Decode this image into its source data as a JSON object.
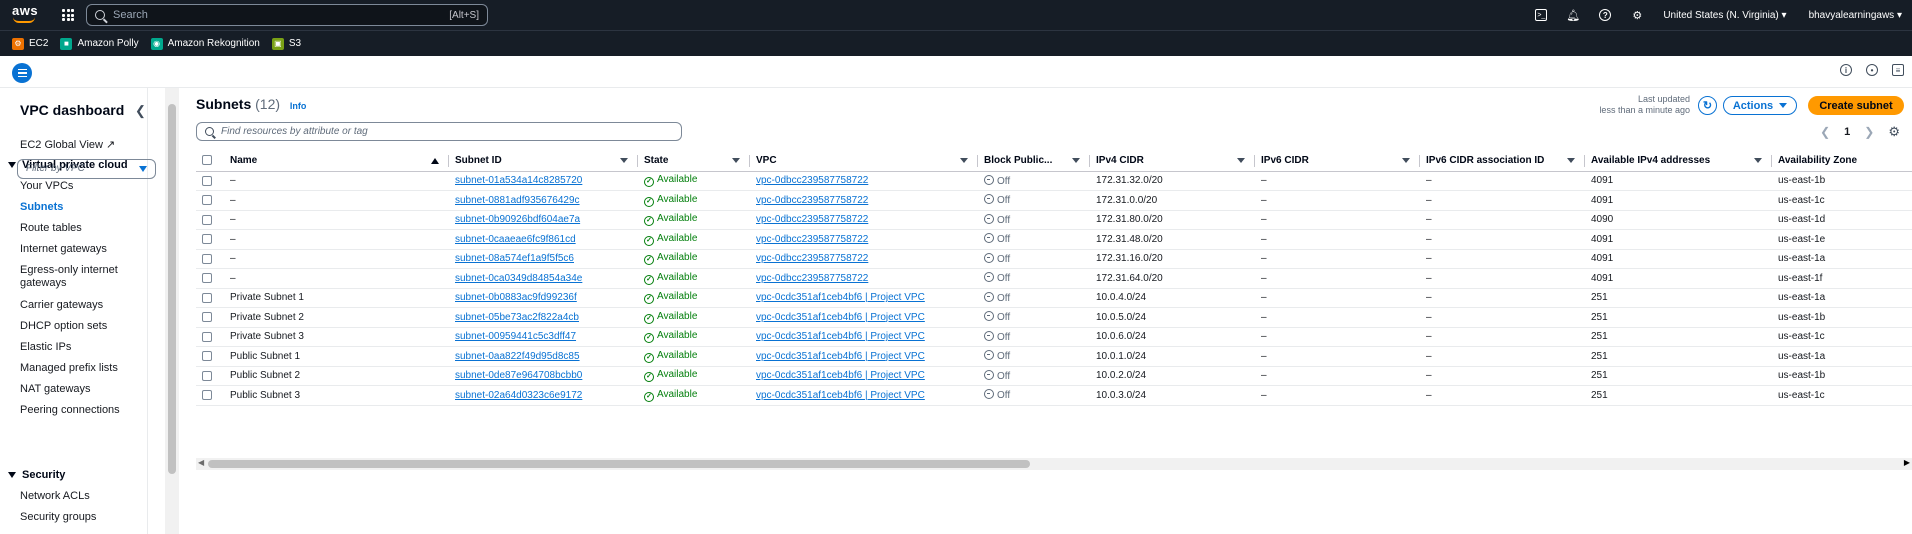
{
  "topnav": {
    "logo_text": "aws",
    "search_placeholder": "Search",
    "search_shortcut": "[Alt+S]",
    "region": "United States (N. Virginia)",
    "user": "bhavyalearningaws"
  },
  "favorites": [
    {
      "label": "EC2",
      "color": "#ed7100",
      "icon": "ec2-icon"
    },
    {
      "label": "Amazon Polly",
      "color": "#01a88d",
      "icon": "polly-icon"
    },
    {
      "label": "Amazon Rekognition",
      "color": "#01a88d",
      "icon": "rekognition-icon"
    },
    {
      "label": "S3",
      "color": "#7aa116",
      "icon": "s3-icon"
    }
  ],
  "sidebar": {
    "title": "VPC dashboard",
    "global_view": "EC2 Global View",
    "filter_placeholder": "Filter by VPC",
    "section_vpc": "Virtual private cloud",
    "items": [
      "Your VPCs",
      "Subnets",
      "Route tables",
      "Internet gateways",
      "Egress-only internet gateways",
      "Carrier gateways",
      "DHCP option sets",
      "Elastic IPs",
      "Managed prefix lists",
      "NAT gateways",
      "Peering connections"
    ],
    "section_security": "Security",
    "security_items": [
      "Network ACLs",
      "Security groups"
    ]
  },
  "main": {
    "title": "Subnets",
    "count": "(12)",
    "info": "Info",
    "last_updated_label": "Last updated",
    "last_updated_value": "less than a minute ago",
    "actions_label": "Actions",
    "create_label": "Create subnet",
    "search_placeholder": "Find resources by attribute or tag",
    "page": "1"
  },
  "table": {
    "columns": [
      "Name",
      "Subnet ID",
      "State",
      "VPC",
      "Block Public...",
      "IPv4 CIDR",
      "IPv6 CIDR",
      "IPv6 CIDR association ID",
      "Available IPv4 addresses",
      "Availability Zone"
    ],
    "rows": [
      {
        "name": "–",
        "subnet_id": "subnet-01a534a14c8285720",
        "state": "Available",
        "vpc": "vpc-0dbcc239587758722",
        "block": "Off",
        "ipv4": "172.31.32.0/20",
        "ipv6": "–",
        "ipv6_assoc": "–",
        "avail_ips": "4091",
        "az": "us-east-1b"
      },
      {
        "name": "–",
        "subnet_id": "subnet-0881adf935676429c",
        "state": "Available",
        "vpc": "vpc-0dbcc239587758722",
        "block": "Off",
        "ipv4": "172.31.0.0/20",
        "ipv6": "–",
        "ipv6_assoc": "–",
        "avail_ips": "4091",
        "az": "us-east-1c"
      },
      {
        "name": "–",
        "subnet_id": "subnet-0b90926bdf604ae7a",
        "state": "Available",
        "vpc": "vpc-0dbcc239587758722",
        "block": "Off",
        "ipv4": "172.31.80.0/20",
        "ipv6": "–",
        "ipv6_assoc": "–",
        "avail_ips": "4090",
        "az": "us-east-1d"
      },
      {
        "name": "–",
        "subnet_id": "subnet-0caaeae6fc9f861cd",
        "state": "Available",
        "vpc": "vpc-0dbcc239587758722",
        "block": "Off",
        "ipv4": "172.31.48.0/20",
        "ipv6": "–",
        "ipv6_assoc": "–",
        "avail_ips": "4091",
        "az": "us-east-1e"
      },
      {
        "name": "–",
        "subnet_id": "subnet-08a574ef1a9f5f5c6",
        "state": "Available",
        "vpc": "vpc-0dbcc239587758722",
        "block": "Off",
        "ipv4": "172.31.16.0/20",
        "ipv6": "–",
        "ipv6_assoc": "–",
        "avail_ips": "4091",
        "az": "us-east-1a"
      },
      {
        "name": "–",
        "subnet_id": "subnet-0ca0349d84854a34e",
        "state": "Available",
        "vpc": "vpc-0dbcc239587758722",
        "block": "Off",
        "ipv4": "172.31.64.0/20",
        "ipv6": "–",
        "ipv6_assoc": "–",
        "avail_ips": "4091",
        "az": "us-east-1f"
      },
      {
        "name": "Private Subnet 1",
        "subnet_id": "subnet-0b0883ac9fd99236f",
        "state": "Available",
        "vpc": "vpc-0cdc351af1ceb4bf6 | Project VPC",
        "block": "Off",
        "ipv4": "10.0.4.0/24",
        "ipv6": "–",
        "ipv6_assoc": "–",
        "avail_ips": "251",
        "az": "us-east-1a"
      },
      {
        "name": "Private Subnet 2",
        "subnet_id": "subnet-05be73ac2f822a4cb",
        "state": "Available",
        "vpc": "vpc-0cdc351af1ceb4bf6 | Project VPC",
        "block": "Off",
        "ipv4": "10.0.5.0/24",
        "ipv6": "–",
        "ipv6_assoc": "–",
        "avail_ips": "251",
        "az": "us-east-1b"
      },
      {
        "name": "Private Subnet 3",
        "subnet_id": "subnet-00959441c5c3dff47",
        "state": "Available",
        "vpc": "vpc-0cdc351af1ceb4bf6 | Project VPC",
        "block": "Off",
        "ipv4": "10.0.6.0/24",
        "ipv6": "–",
        "ipv6_assoc": "–",
        "avail_ips": "251",
        "az": "us-east-1c"
      },
      {
        "name": "Public Subnet 1",
        "subnet_id": "subnet-0aa822f49d95d8c85",
        "state": "Available",
        "vpc": "vpc-0cdc351af1ceb4bf6 | Project VPC",
        "block": "Off",
        "ipv4": "10.0.1.0/24",
        "ipv6": "–",
        "ipv6_assoc": "–",
        "avail_ips": "251",
        "az": "us-east-1a"
      },
      {
        "name": "Public Subnet 2",
        "subnet_id": "subnet-0de87e964708bcbb0",
        "state": "Available",
        "vpc": "vpc-0cdc351af1ceb4bf6 | Project VPC",
        "block": "Off",
        "ipv4": "10.0.2.0/24",
        "ipv6": "–",
        "ipv6_assoc": "–",
        "avail_ips": "251",
        "az": "us-east-1b"
      },
      {
        "name": "Public Subnet 3",
        "subnet_id": "subnet-02a64d0323c6e9172",
        "state": "Available",
        "vpc": "vpc-0cdc351af1ceb4bf6 | Project VPC",
        "block": "Off",
        "ipv4": "10.0.3.0/24",
        "ipv6": "–",
        "ipv6_assoc": "–",
        "avail_ips": "251",
        "az": "us-east-1c"
      }
    ]
  },
  "colors": {
    "nav_bg": "#161d26",
    "link": "#0972d3",
    "primary_button": "#ff9900",
    "success": "#037f0c"
  }
}
